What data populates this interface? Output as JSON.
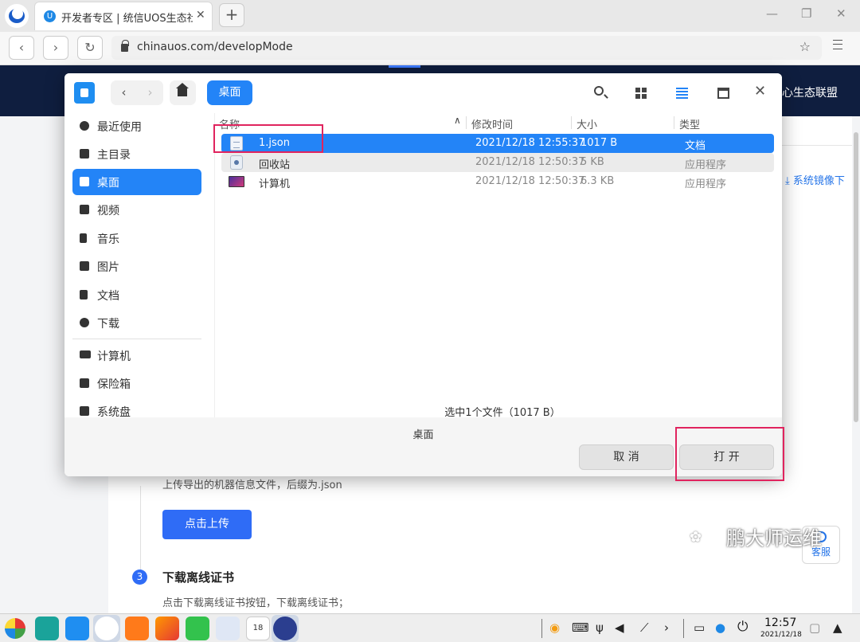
{
  "browser": {
    "tab_title": "开发者专区 | 统信UOS生态社区",
    "tab_favicon": "U",
    "url": "chinauos.com/developMode",
    "icons": [
      "back-icon",
      "forward-icon",
      "reload-icon",
      "lock-icon",
      "star-icon",
      "menu-icon",
      "minimize-icon",
      "maximize-icon",
      "close-icon",
      "new-tab-icon"
    ]
  },
  "page": {
    "header_link": "心生态联盟",
    "mirror_link": "⤓ 系统镜像下",
    "upload_hint": "上传导出的机器信息文件，后缀为.json",
    "upload_button": "点击上传",
    "step_number": "3",
    "step_title": "下载离线证书",
    "step_desc": "点击下载离线证书按钮，下载离线证书；",
    "service_label": "客服",
    "watermark": "鹏大师运维",
    "accent_color": "#2f6cf6"
  },
  "dialog": {
    "breadcrumb": "桌面",
    "sidebar": [
      {
        "label": "最近使用",
        "icon": "clock-icon"
      },
      {
        "label": "主目录",
        "icon": "home-icon"
      },
      {
        "label": "桌面",
        "icon": "desktop-icon",
        "active": true
      },
      {
        "label": "视频",
        "icon": "video-icon"
      },
      {
        "label": "音乐",
        "icon": "music-icon"
      },
      {
        "label": "图片",
        "icon": "picture-icon"
      },
      {
        "label": "文档",
        "icon": "document-icon"
      },
      {
        "label": "下载",
        "icon": "download-icon"
      },
      {
        "label": "计算机",
        "icon": "computer-icon"
      },
      {
        "label": "保险箱",
        "icon": "safe-icon"
      },
      {
        "label": "系统盘",
        "icon": "disk-icon"
      }
    ],
    "columns": {
      "name": "名称",
      "modified": "修改时间",
      "size": "大小",
      "type": "类型"
    },
    "files": [
      {
        "name": "1.json",
        "modified": "2021/12/18 12:55:37",
        "size": "1017 B",
        "type": "文档",
        "icon": "document-file-icon",
        "selected": true
      },
      {
        "name": "回收站",
        "modified": "2021/12/18 12:50:37",
        "size": "5 KB",
        "type": "应用程序",
        "icon": "trash-app-icon"
      },
      {
        "name": "计算机",
        "modified": "2021/12/18 12:50:37",
        "size": "6.3 KB",
        "type": "应用程序",
        "icon": "computer-app-icon"
      }
    ],
    "status": "选中1个文件（1017 B）",
    "location": "桌面",
    "cancel_button": "取 消",
    "open_button": "打 开",
    "selection_color": "#2384f7",
    "highlight_color": "#e0245e"
  },
  "taskbar": {
    "time": "12:57",
    "date": "2021/12/18",
    "calendar_day": "18"
  }
}
